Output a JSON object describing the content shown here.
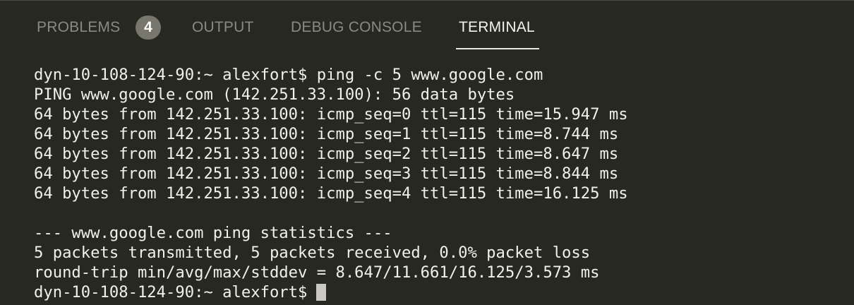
{
  "tabs": [
    {
      "label": "PROBLEMS",
      "badge": "4",
      "active": false
    },
    {
      "label": "OUTPUT",
      "active": false
    },
    {
      "label": "DEBUG CONSOLE",
      "active": false
    },
    {
      "label": "TERMINAL",
      "active": true
    }
  ],
  "terminal": {
    "lines": [
      "dyn-10-108-124-90:~ alexfort$ ping -c 5 www.google.com",
      "PING www.google.com (142.251.33.100): 56 data bytes",
      "64 bytes from 142.251.33.100: icmp_seq=0 ttl=115 time=15.947 ms",
      "64 bytes from 142.251.33.100: icmp_seq=1 ttl=115 time=8.744 ms",
      "64 bytes from 142.251.33.100: icmp_seq=2 ttl=115 time=8.647 ms",
      "64 bytes from 142.251.33.100: icmp_seq=3 ttl=115 time=8.844 ms",
      "64 bytes from 142.251.33.100: icmp_seq=4 ttl=115 time=16.125 ms",
      "",
      "--- www.google.com ping statistics ---",
      "5 packets transmitted, 5 packets received, 0.0% packet loss",
      "round-trip min/avg/max/stddev = 8.647/11.661/16.125/3.573 ms"
    ],
    "prompt": "dyn-10-108-124-90:~ alexfort$"
  },
  "colors": {
    "background": "#272822",
    "text": "#f1f1ea",
    "inactive_tab": "#8b8a80",
    "active_tab": "#f4f4ef",
    "badge_bg": "#78776d",
    "cursor": "#c9c9c2"
  }
}
